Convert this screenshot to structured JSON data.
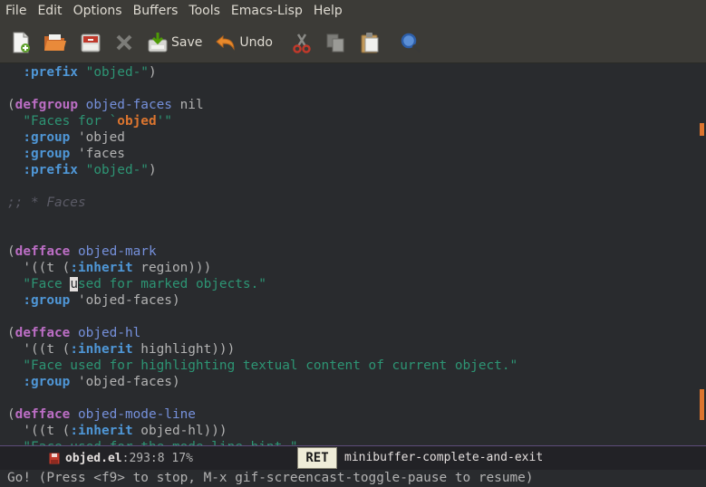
{
  "menu": [
    "File",
    "Edit",
    "Options",
    "Buffers",
    "Tools",
    "Emacs-Lisp",
    "Help"
  ],
  "toolbar": {
    "save_label": "Save",
    "undo_label": "Undo"
  },
  "editor_lines": [
    "  :prefix \"objed-\")",
    "",
    "(defgroup objed-faces nil",
    "  \"Faces for `objed'\"",
    "  :group 'objed",
    "  :group 'faces",
    "  :prefix \"objed-\")",
    "",
    ";; * Faces",
    "",
    "",
    "(defface objed-mark",
    "  '((t (:inherit region)))",
    "  \"Face used for marked objects.\"",
    "  :group 'objed-faces)",
    "",
    "(defface objed-hl",
    "  '((t (:inherit highlight)))",
    "  \"Face used for highlighting textual content of current object.\"",
    "  :group 'objed-faces)",
    "",
    "(defface objed-mode-line",
    "  '((t (:inherit objed-hl)))",
    "  \"Face used for the mode line hint.\""
  ],
  "modeline": {
    "filename": "objed.el",
    "position": ":293:8 17%",
    "key": "RET",
    "command": "minibuffer-complete-and-exit"
  },
  "minibuffer": "Go! (Press <f9> to stop, M-x gif-screencast-toggle-pause to resume)",
  "colors": {
    "background": "#292b2e",
    "keyword": "#4f97d7",
    "defform": "#bc6ec5",
    "string": "#2d9574",
    "accent": "#dc752f"
  }
}
